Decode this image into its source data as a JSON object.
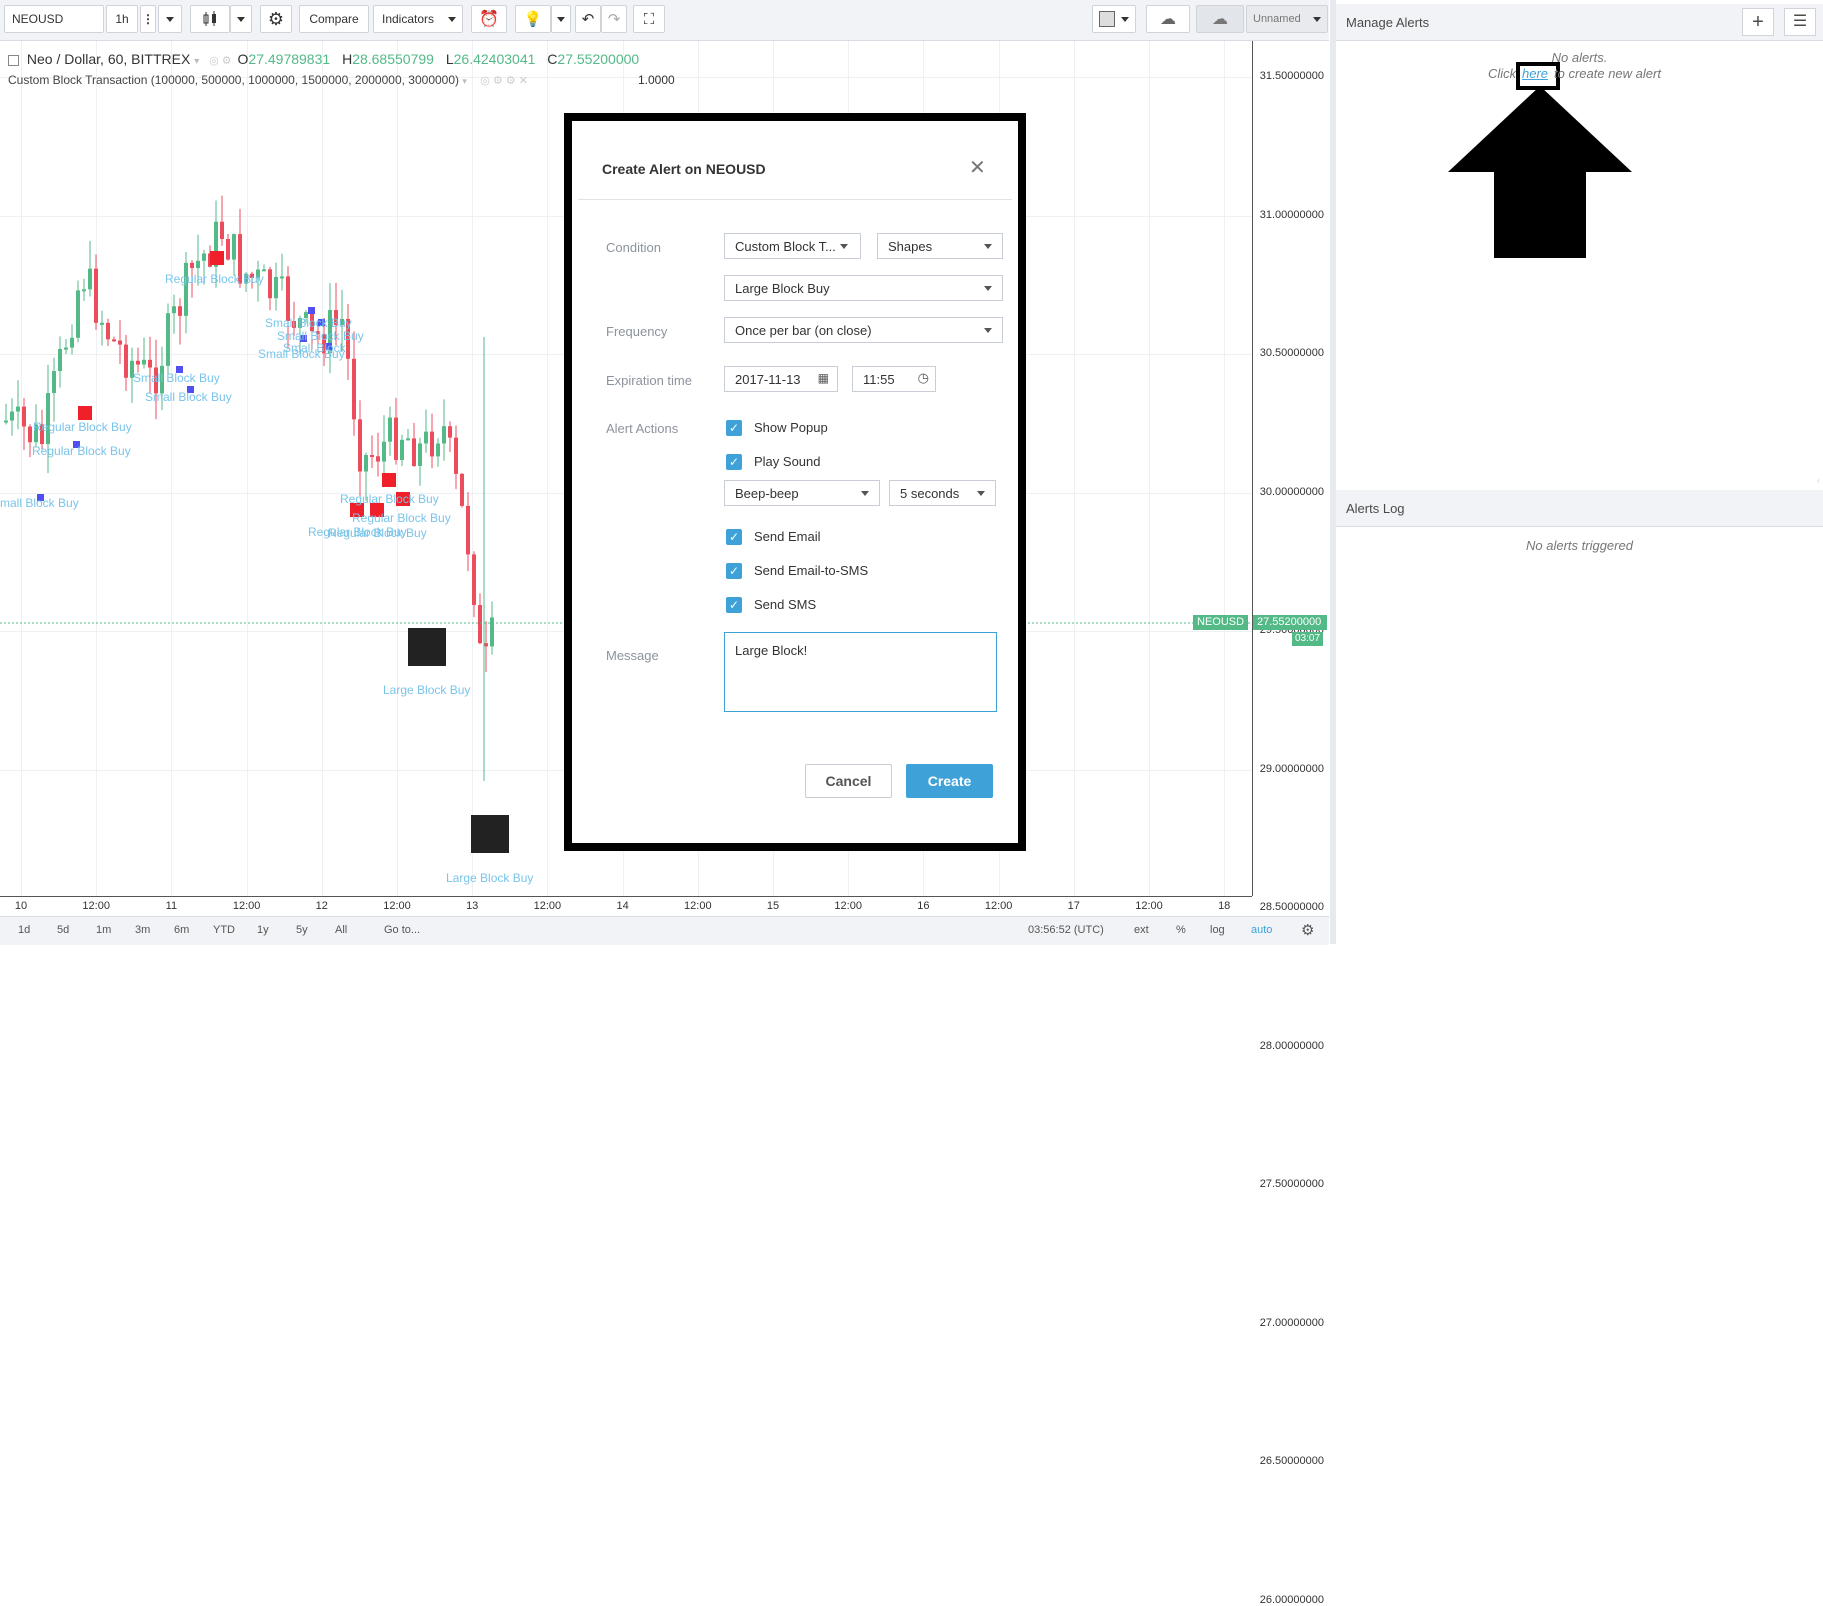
{
  "toolbar": {
    "symbol": "NEOUSD",
    "interval": "1h",
    "compare_label": "Compare",
    "indicators_label": "Indicators",
    "layout_name": "Unnamed"
  },
  "chart": {
    "legend_symbol": "Neo / Dollar, 60, BITTREX",
    "ohlc": {
      "o_label": "O",
      "o": "27.49789831",
      "h_label": "H",
      "h": "28.68550799",
      "l_label": "L",
      "l": "26.42403041",
      "c_label": "C",
      "c": "27.55200000"
    },
    "indicator_legend": "Custom Block Transaction (100000, 500000, 1000000, 1500000, 2000000, 3000000)",
    "indicator_value": "1.0000",
    "price_ticks": [
      "31.50000000",
      "31.00000000",
      "30.50000000",
      "30.00000000",
      "29.50000000",
      "29.00000000",
      "28.50000000",
      "28.00000000",
      "27.50000000",
      "27.00000000",
      "26.50000000",
      "26.00000000"
    ],
    "time_ticks": [
      "10",
      "12:00",
      "11",
      "12:00",
      "12",
      "12:00",
      "13",
      "12:00",
      "14",
      "12:00",
      "15",
      "12:00",
      "16",
      "12:00",
      "17",
      "12:00",
      "18"
    ],
    "last_price_symbol": "NEOUSD",
    "last_price": "27.55200000",
    "countdown": "03:07",
    "annotations": {
      "regular_block_buy": "Regular Block Buy",
      "small_block_buy": "Small Block Buy",
      "large_block_buy": "Large Block Buy",
      "small_block": "Small Block",
      "small_block_buy_partial": "mall Block Buy"
    }
  },
  "bottombar": {
    "ranges": [
      "1d",
      "5d",
      "1m",
      "3m",
      "6m",
      "YTD",
      "1y",
      "5y",
      "All"
    ],
    "goto": "Go to...",
    "clock": "03:56:52 (UTC)",
    "ext": "ext",
    "percent": "%",
    "log": "log",
    "auto": "auto"
  },
  "alerts_panel": {
    "manage_title": "Manage Alerts",
    "no_alerts": "No alerts.",
    "click_prefix": "Click",
    "here_link": "here",
    "click_suffix": "to create new alert",
    "log_title": "Alerts Log",
    "no_alerts_triggered": "No alerts triggered"
  },
  "dialog": {
    "title": "Create Alert on NEOUSD",
    "condition_label": "Condition",
    "condition_value": "Custom Block T...",
    "condition_plot": "Shapes",
    "condition_shape": "Large Block Buy",
    "frequency_label": "Frequency",
    "frequency_value": "Once per bar (on close)",
    "expiration_label": "Expiration time",
    "expiration_date": "2017-11-13",
    "expiration_time": "11:55",
    "actions_label": "Alert Actions",
    "show_popup": "Show Popup",
    "play_sound": "Play Sound",
    "sound_name": "Beep-beep",
    "sound_duration": "5 seconds",
    "send_email": "Send Email",
    "send_email_sms": "Send Email-to-SMS",
    "send_sms": "Send SMS",
    "message_label": "Message",
    "message_value": "Large Block!",
    "cancel_label": "Cancel",
    "create_label": "Create"
  },
  "colors": {
    "up": "#53b987",
    "down": "#eb4d5c",
    "accent": "#3ea2d9",
    "label_text": "#79c4ea",
    "small_marker": "#5050f0",
    "regular_marker": "#f0202a",
    "large_marker": "#222222"
  }
}
